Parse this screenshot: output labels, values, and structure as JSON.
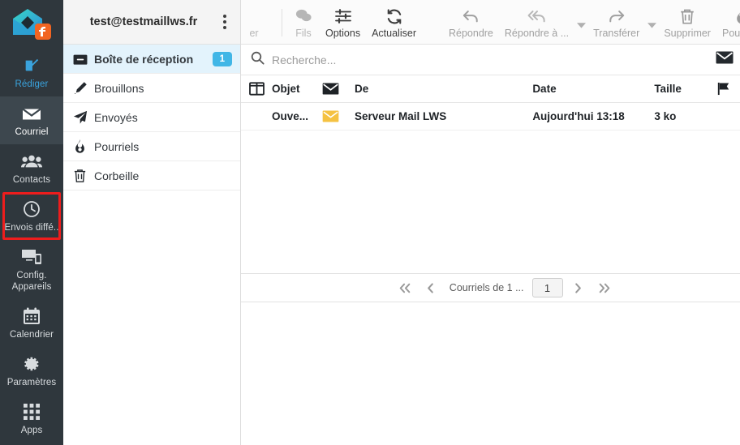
{
  "colors": {
    "rail_bg": "#2f373d",
    "rail_active_bg": "#3d474e",
    "accent_blue": "#3aa3dd",
    "badge_blue": "#41b6e6",
    "selected_folder_bg": "#e3f3fc",
    "highlight_box": "#ee1d1d",
    "unread_envelope": "#f5c242",
    "logo_teal": "#3fc6c6",
    "logo_orange": "#f26522"
  },
  "rail": {
    "logo_name": "lws-mail-logo",
    "items": [
      {
        "label": "Rédiger",
        "icon": "compose-icon",
        "state": "accent"
      },
      {
        "label": "Courriel",
        "icon": "envelope-icon",
        "state": "active"
      },
      {
        "label": "Contacts",
        "icon": "contacts-icon",
        "state": "normal"
      },
      {
        "label": "Envois diffé..",
        "icon": "clock-icon",
        "state": "highlighted"
      },
      {
        "label": "Config. Appareils",
        "icon": "devices-icon",
        "state": "normal"
      },
      {
        "label": "Calendrier",
        "icon": "calendar-icon",
        "state": "normal"
      },
      {
        "label": "Paramètres",
        "icon": "gear-icon",
        "state": "normal"
      },
      {
        "label": "Apps",
        "icon": "grid-apps-icon",
        "state": "normal"
      }
    ]
  },
  "account": {
    "name": "test@testmaillws.fr",
    "menu_icon": "kebab-menu-icon"
  },
  "folders": [
    {
      "label": "Boîte de réception",
      "icon": "inbox-icon",
      "badge": "1",
      "selected": true
    },
    {
      "label": "Brouillons",
      "icon": "pencil-icon",
      "badge": "",
      "selected": false
    },
    {
      "label": "Envoyés",
      "icon": "paper-plane-icon",
      "badge": "",
      "selected": false
    },
    {
      "label": "Pourriels",
      "icon": "flame-icon",
      "badge": "",
      "selected": false
    },
    {
      "label": "Corbeille",
      "icon": "trash-icon",
      "badge": "",
      "selected": false
    }
  ],
  "toolbar": {
    "clipped_label": "er",
    "buttons": [
      {
        "label": "Fils",
        "icon": "threads-icon",
        "state": "dim"
      },
      {
        "label": "Options",
        "icon": "sliders-icon",
        "state": "normal"
      },
      {
        "label": "Actualiser",
        "icon": "refresh-icon",
        "state": "normal"
      },
      {
        "label": "Répondre",
        "icon": "reply-icon",
        "state": "dim2"
      },
      {
        "label": "Répondre à ...",
        "icon": "reply-all-icon",
        "state": "dim2"
      },
      {
        "label": "Transférer",
        "icon": "forward-icon",
        "state": "dim2"
      },
      {
        "label": "Supprimer",
        "icon": "trash-icon",
        "state": "dim2"
      },
      {
        "label": "Pourriels",
        "icon": "flame-icon",
        "state": "dim2"
      }
    ]
  },
  "search": {
    "placeholder": "Recherche...",
    "value": "",
    "icon": "search-icon",
    "scope_icon": "envelope-icon",
    "dropdown_icon": "chevron-down-icon"
  },
  "list": {
    "columns": {
      "layout_icon": "column-layout-icon",
      "objet": "Objet",
      "read_icon": "envelope-icon",
      "de": "De",
      "date": "Date",
      "taille": "Taille",
      "flag_icon": "flag-icon",
      "attachment_icon": "paperclip-icon"
    },
    "rows": [
      {
        "objet": "Ouve...",
        "status_icon": "unread-envelope-icon",
        "de": "Serveur Mail LWS",
        "date": "Aujourd'hui 13:18",
        "taille": "3 ko",
        "flag": "",
        "attachment": ""
      }
    ]
  },
  "pager": {
    "first_icon": "double-chevron-left-icon",
    "prev_icon": "chevron-left-icon",
    "label": "Courriels de 1 ...",
    "page": "1",
    "next_icon": "chevron-right-icon",
    "last_icon": "double-chevron-right-icon"
  }
}
